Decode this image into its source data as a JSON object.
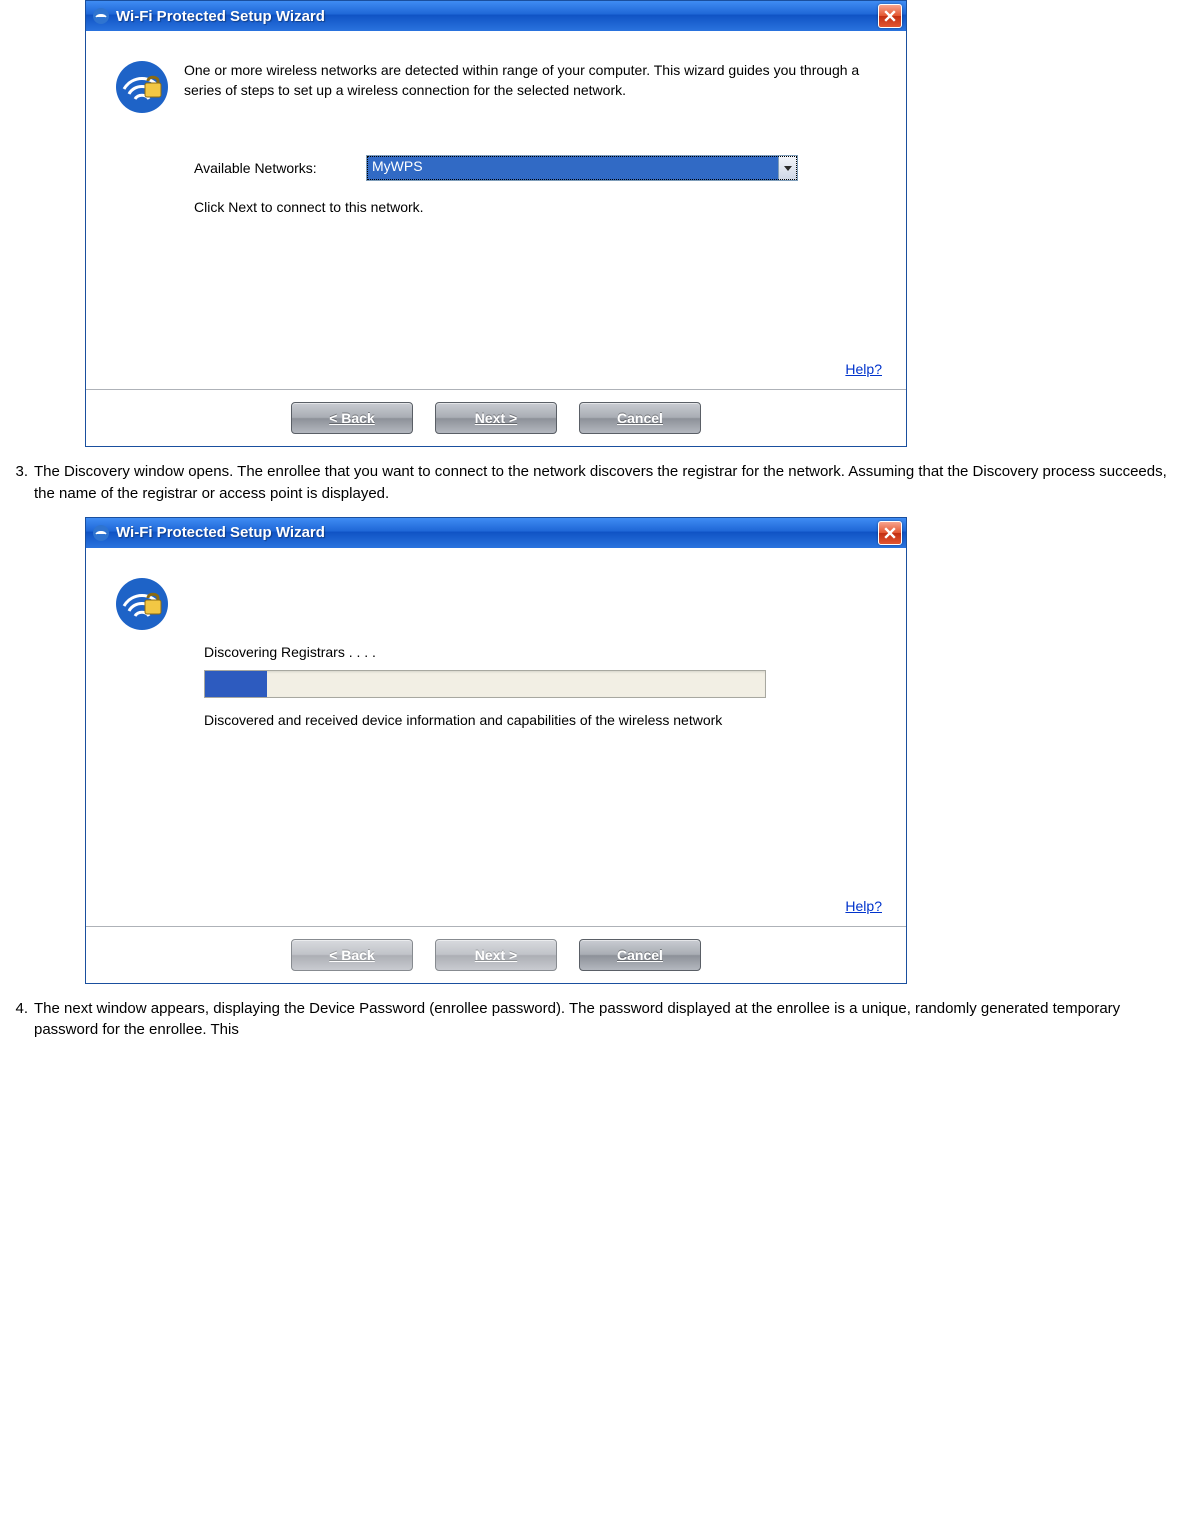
{
  "wizard1": {
    "title": "Wi-Fi Protected Setup Wizard",
    "intro": "One or more wireless networks are detected within range of your computer. This wizard guides you through a series of steps to set up a wireless connection for the selected network.",
    "available_label": "Available Networks:",
    "available_value": "MyWPS",
    "hint": "Click Next to connect to this network.",
    "help": "Help?",
    "back": "< Back",
    "next": "Next >",
    "cancel": "Cancel"
  },
  "step3": {
    "num": "3.",
    "text": "The Discovery window opens. The enrollee that you want to connect to the network discovers the registrar for the network. Assuming that the Discovery process succeeds, the name of the registrar or access point is displayed."
  },
  "wizard2": {
    "title": "Wi-Fi Protected Setup Wizard",
    "discovering": "Discovering Registrars . . . .",
    "progress_percent": 11,
    "discovered": "Discovered and received device information and capabilities of the wireless network",
    "help": "Help?",
    "back": "< Back",
    "next": "Next >",
    "cancel": "Cancel"
  },
  "step4": {
    "num": "4.",
    "text": "The next window appears, displaying the Device Password (enrollee password). The password displayed at the enrollee is a unique, randomly generated temporary password for the enrollee. This"
  }
}
